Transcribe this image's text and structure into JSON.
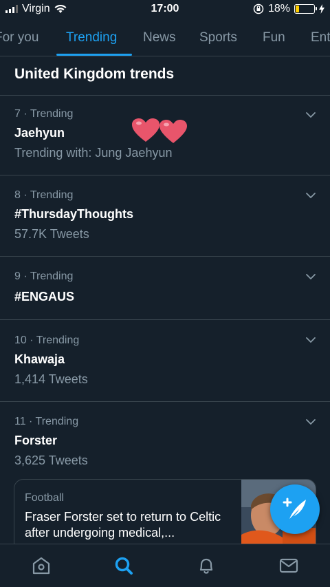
{
  "status_bar": {
    "carrier": "Virgin",
    "time": "17:00",
    "battery": "18%",
    "battery_level": 0.18,
    "battery_color": "#ffcc00"
  },
  "tabs": [
    {
      "label": "For you",
      "active": false
    },
    {
      "label": "Trending",
      "active": true
    },
    {
      "label": "News",
      "active": false
    },
    {
      "label": "Sports",
      "active": false
    },
    {
      "label": "Fun",
      "active": false
    },
    {
      "label": "Entertainment",
      "active": false
    }
  ],
  "section": {
    "title": "United Kingdom trends"
  },
  "trends": [
    {
      "meta": "7 · Trending",
      "title": "Jaehyun",
      "subtitle": "Trending with: Jung Jaehyun"
    },
    {
      "meta": "8 · Trending",
      "title": "#ThursdayThoughts",
      "subtitle": "57.7K Tweets"
    },
    {
      "meta": "9 · Trending",
      "title": "#ENGAUS",
      "subtitle": ""
    },
    {
      "meta": "10 · Trending",
      "title": "Khawaja",
      "subtitle": "1,414 Tweets"
    },
    {
      "meta": "11 · Trending",
      "title": "Forster",
      "subtitle": "3,625 Tweets"
    }
  ],
  "news_card": {
    "category": "Football",
    "headline": "Fraser Forster set to return to Celtic after undergoing medical,..."
  },
  "bottom_nav": [
    "home-icon",
    "search-icon",
    "notifications-icon",
    "messages-icon"
  ],
  "colors": {
    "background": "#15202b",
    "accent": "#1da1f2",
    "secondary_text": "#8899a6",
    "divider": "#38444d"
  }
}
